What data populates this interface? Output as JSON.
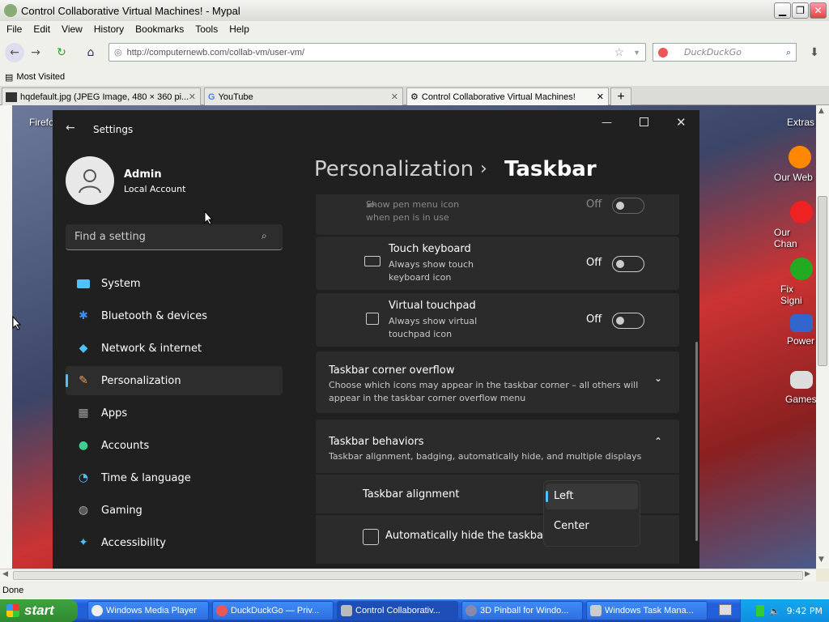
{
  "browser": {
    "window_title": "Control Collaborative Virtual Machines! - Mypal",
    "menu": [
      "File",
      "Edit",
      "View",
      "History",
      "Bookmarks",
      "Tools",
      "Help"
    ],
    "url": "http://computernewb.com/collab-vm/user-vm/",
    "search_placeholder": "DuckDuckGo",
    "bookmarks_label": "Most Visited",
    "tabs": [
      {
        "title": "hqdefault.jpg (JPEG Image, 480 × 360 pi..."
      },
      {
        "title": "YouTube"
      },
      {
        "title": "Control Collaborative Virtual Machines!"
      }
    ],
    "status": "Done"
  },
  "desktop_icons": [
    "Firefo",
    "Extras",
    "Our Web",
    "Our Chan",
    "Fix Signi",
    "Power",
    "Games"
  ],
  "settings": {
    "app_title": "Settings",
    "user_name": "Admin",
    "user_type": "Local Account",
    "search_placeholder": "Find a setting",
    "nav": [
      {
        "label": "System",
        "icon": "monitor-icon",
        "color": "#4cc2ff"
      },
      {
        "label": "Bluetooth & devices",
        "icon": "bluetooth-icon",
        "color": "#3b8eea"
      },
      {
        "label": "Network & internet",
        "icon": "wifi-icon",
        "color": "#4cc2ff"
      },
      {
        "label": "Personalization",
        "icon": "brush-icon",
        "color": "#e8a050"
      },
      {
        "label": "Apps",
        "icon": "apps-icon",
        "color": "#9aa0a6"
      },
      {
        "label": "Accounts",
        "icon": "person-icon",
        "color": "#3ecf8e"
      },
      {
        "label": "Time & language",
        "icon": "clock-globe-icon",
        "color": "#4cc2ff"
      },
      {
        "label": "Gaming",
        "icon": "gamepad-icon",
        "color": "#b0b0b0"
      },
      {
        "label": "Accessibility",
        "icon": "accessibility-icon",
        "color": "#4cc2ff"
      }
    ],
    "breadcrumb_parent": "Personalization",
    "breadcrumb_sep": "›",
    "breadcrumb_current": "Taskbar",
    "pen_menu": {
      "desc1": "Show pen menu icon",
      "desc2": "when pen is in use",
      "state": "Off"
    },
    "touch_keyboard": {
      "title": "Touch keyboard",
      "desc1": "Always show touch",
      "desc2": "keyboard icon",
      "state": "Off"
    },
    "virtual_touchpad": {
      "title": "Virtual touchpad",
      "desc1": "Always show virtual",
      "desc2": "touchpad icon",
      "state": "Off"
    },
    "corner_overflow": {
      "title": "Taskbar corner overflow",
      "desc1": "Choose which icons may appear in the taskbar corner – all others will",
      "desc2": "appear in the taskbar corner overflow menu"
    },
    "behaviors": {
      "title": "Taskbar behaviors",
      "desc": "Taskbar alignment, badging, automatically hide, and multiple displays"
    },
    "alignment_label": "Taskbar alignment",
    "alignment_options": [
      "Left",
      "Center"
    ],
    "autohide_label": "Automatically hide the taskbar"
  },
  "taskbar": {
    "start_label": "start",
    "buttons": [
      "Windows Media Player",
      "DuckDuckGo — Priv...",
      "Control Collaborativ...",
      "3D Pinball for Windo...",
      "Windows Task Mana..."
    ],
    "clock": "9:42 PM"
  }
}
